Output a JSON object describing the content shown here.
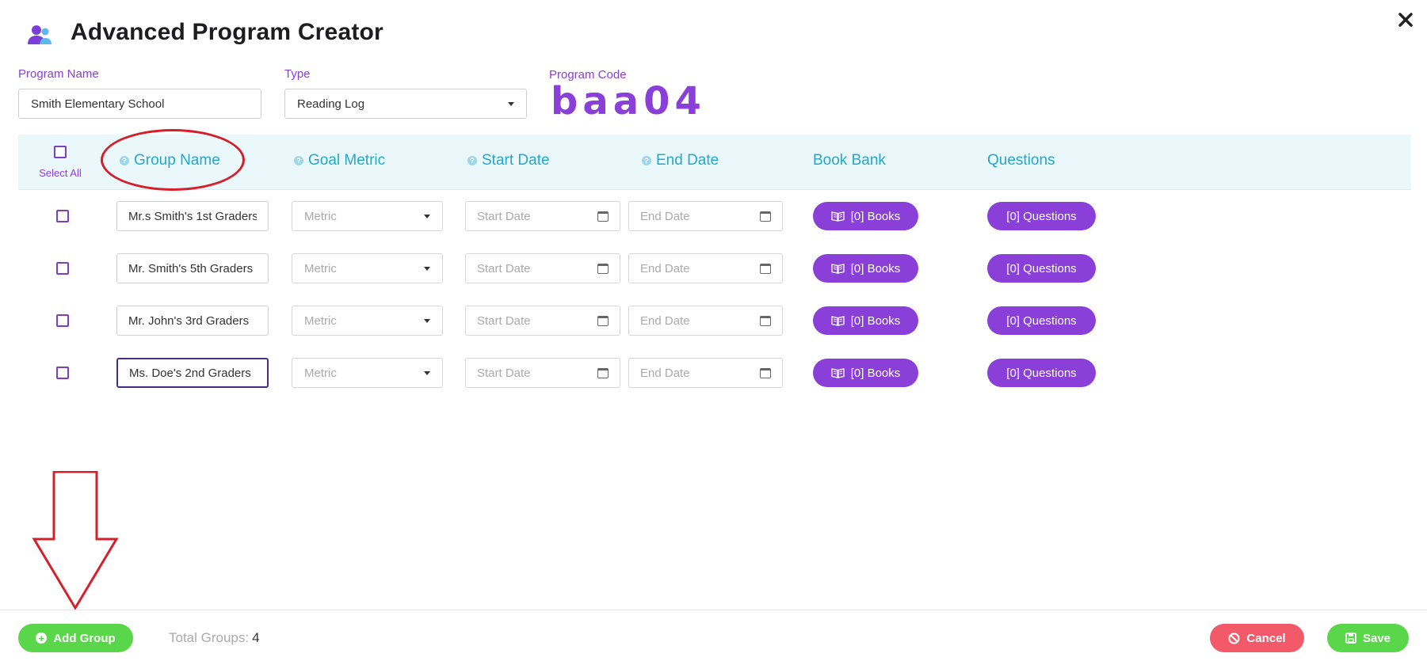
{
  "header": {
    "title": "Advanced Program Creator",
    "close_icon": "close-x-icon",
    "app_icon": "users-group-icon"
  },
  "program": {
    "name_label": "Program Name",
    "name_value": "Smith Elementary School",
    "type_label": "Type",
    "type_value": "Reading Log",
    "code_label": "Program Code",
    "code_value": "baa04"
  },
  "table": {
    "select_all_label": "Select All",
    "columns": {
      "group_name": "Group Name",
      "goal_metric": "Goal Metric",
      "start_date": "Start Date",
      "end_date": "End Date",
      "book_bank": "Book Bank",
      "questions": "Questions"
    },
    "rows": [
      {
        "group_name": "Mr.s Smith's 1st Graders",
        "metric_placeholder": "Metric",
        "start_placeholder": "Start Date",
        "end_placeholder": "End Date",
        "books_label": "[0] Books",
        "questions_label": "[0] Questions"
      },
      {
        "group_name": "Mr. Smith's 5th Graders",
        "metric_placeholder": "Metric",
        "start_placeholder": "Start Date",
        "end_placeholder": "End Date",
        "books_label": "[0] Books",
        "questions_label": "[0] Questions"
      },
      {
        "group_name": "Mr. John's 3rd Graders",
        "metric_placeholder": "Metric",
        "start_placeholder": "Start Date",
        "end_placeholder": "End Date",
        "books_label": "[0] Books",
        "questions_label": "[0] Questions"
      },
      {
        "group_name": "Ms. Doe's 2nd Graders",
        "metric_placeholder": "Metric",
        "start_placeholder": "Start Date",
        "end_placeholder": "End Date",
        "books_label": "[0] Books",
        "questions_label": "[0] Questions"
      }
    ]
  },
  "footer": {
    "add_group_label": "Add Group",
    "total_label": "Total Groups:",
    "total_value": "4",
    "cancel_label": "Cancel",
    "save_label": "Save"
  },
  "colors": {
    "accent_purple": "#8a3fd9",
    "header_teal": "#25a8c9",
    "success_green": "#5ad64a",
    "danger_red": "#f25a6a",
    "annotation_red": "#d4202a"
  }
}
